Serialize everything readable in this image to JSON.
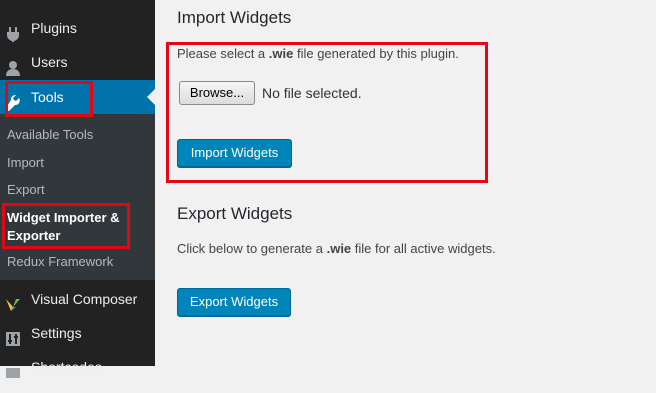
{
  "sidebar": {
    "menu": [
      {
        "label": "Plugins",
        "icon": "plug-icon"
      },
      {
        "label": "Users",
        "icon": "users-icon"
      },
      {
        "label": "Tools",
        "icon": "wrench-icon"
      },
      {
        "label": "Visual Composer",
        "icon": "visual-composer-icon"
      },
      {
        "label": "Settings",
        "icon": "settings-icon"
      },
      {
        "label": "Shortcodes",
        "icon": "shortcodes-icon"
      }
    ],
    "submenu": [
      "Available Tools",
      "Import",
      "Export",
      "Widget Importer & Exporter",
      "Redux Framework"
    ],
    "current_submenu_line1": "Widget Importer &",
    "current_submenu_line2": "Exporter"
  },
  "import": {
    "title": "Import Widgets",
    "desc_before": "Please select a ",
    "desc_ext": ".wie",
    "desc_after": " file generated by this plugin.",
    "browse_label": "Browse...",
    "file_status": "No file selected.",
    "button_label": "Import Widgets"
  },
  "export": {
    "title": "Export Widgets",
    "desc_before": "Click below to generate a ",
    "desc_ext": ".wie",
    "desc_after": " file for all active widgets.",
    "button_label": "Export Widgets"
  },
  "colors": {
    "accent": "#0073aa",
    "button": "#0085ba",
    "highlight": "#e30613"
  }
}
